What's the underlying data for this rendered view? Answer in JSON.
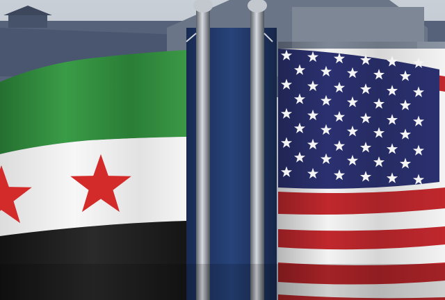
{
  "image": {
    "subjects": [
      "syrian-revolution-flag",
      "united-states-flag"
    ],
    "caption_text": "",
    "colors": {
      "sky": "#b9c0c8",
      "building": "#5d6a7c",
      "syrian_green": "#2f8a3c",
      "syrian_white": "#f2f2f0",
      "syrian_black": "#1a1a1a",
      "syrian_star_red": "#d32a2a",
      "us_blue": "#2b3170",
      "us_red": "#c0282d",
      "us_white": "#f3f3f3",
      "pole": "#9aa1ab",
      "banner_blue": "#1f3566"
    }
  }
}
